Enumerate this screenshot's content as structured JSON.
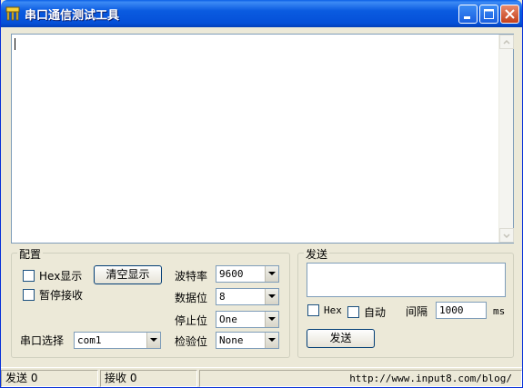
{
  "window": {
    "title": "串口通信测试工具"
  },
  "output": {
    "text": ""
  },
  "config": {
    "legend": "配置",
    "hex_display_label": "Hex显示",
    "pause_receive_label": "暂停接收",
    "clear_display_label": "清空显示",
    "port_select_label": "串口选择",
    "port_value": "com1",
    "baud_label": "波特率",
    "baud_value": "9600",
    "databits_label": "数据位",
    "databits_value": "8",
    "stopbits_label": "停止位",
    "stopbits_value": "One",
    "parity_label": "检验位",
    "parity_value": "None"
  },
  "send": {
    "legend": "发送",
    "input_value": "",
    "hex_label": "Hex",
    "auto_label": "自动",
    "interval_label": "间隔",
    "interval_value": "1000",
    "interval_unit": "ms",
    "send_button_label": "发送"
  },
  "status": {
    "sent_label": "发送 0",
    "received_label": "接收 0",
    "url": "http://www.input8.com/blog/"
  },
  "colors": {
    "titlebar": "#0a5be0",
    "window_bg": "#ece9d8",
    "close_button": "#c4401c"
  }
}
